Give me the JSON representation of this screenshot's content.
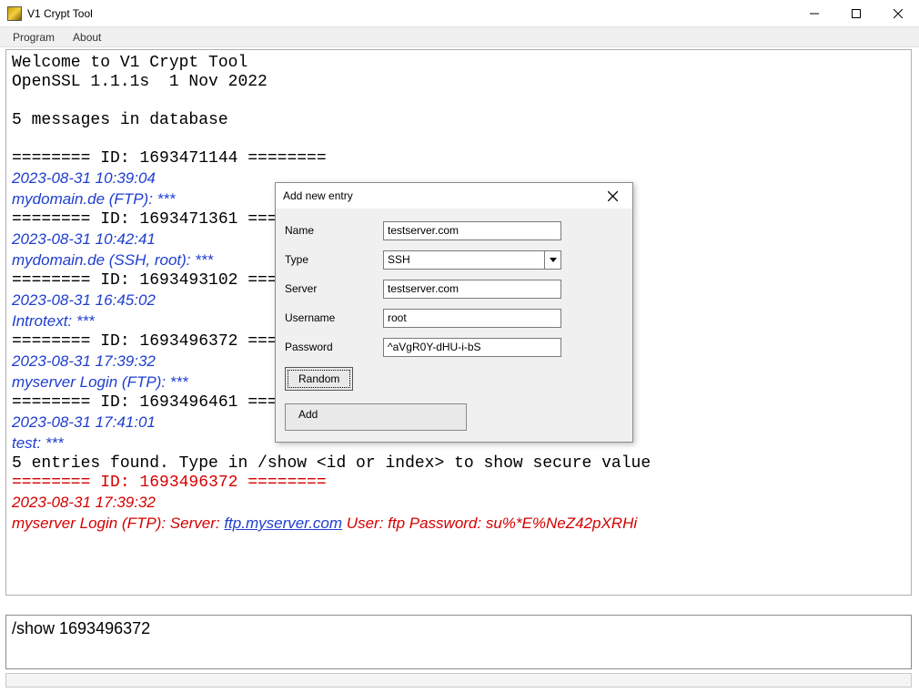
{
  "window": {
    "title": "V1 Crypt Tool",
    "menu": {
      "program": "Program",
      "about": "About"
    }
  },
  "output": {
    "welcome": "Welcome to V1 Crypt Tool",
    "openssl": "OpenSSL 1.1.1s  1 Nov 2022",
    "dbcount": "5 messages in database",
    "entries": [
      {
        "idline": "======== ID: 1693471144 ========",
        "date": "2023-08-31 10:39:04",
        "desc": "mydomain.de (FTP): ***"
      },
      {
        "idline": "======== ID: 1693471361 ========",
        "date": "2023-08-31 10:42:41",
        "desc": "mydomain.de (SSH, root): ***"
      },
      {
        "idline": "======== ID: 1693493102 ========",
        "date": "2023-08-31 16:45:02",
        "desc": "Introtext: ***"
      },
      {
        "idline": "======== ID: 1693496372 ========",
        "date": "2023-08-31 17:39:32",
        "desc": "myserver Login (FTP): ***"
      },
      {
        "idline": "======== ID: 1693496461 ========",
        "date": "2023-08-31 17:41:01",
        "desc": "test: ***"
      }
    ],
    "found": "5 entries found. Type in /show <id or index> to show secure value",
    "show": {
      "idline": "======== ID: 1693496372 ========",
      "date": "2023-08-31 17:39:32",
      "prefix": "myserver Login (FTP): Server: ",
      "link": "ftp.myserver.com",
      "suffix": " User: ftp Password: su%*E%NeZ42pXRHi"
    }
  },
  "input": {
    "value": "/show 1693496372"
  },
  "dialog": {
    "title": "Add new entry",
    "labels": {
      "name": "Name",
      "type": "Type",
      "server": "Server",
      "username": "Username",
      "password": "Password"
    },
    "values": {
      "name": "testserver.com",
      "type": "SSH",
      "server": "testserver.com",
      "username": "root",
      "password": "^aVgR0Y-dHU-i-bS"
    },
    "random_btn": "Random",
    "add_btn": "Add"
  }
}
